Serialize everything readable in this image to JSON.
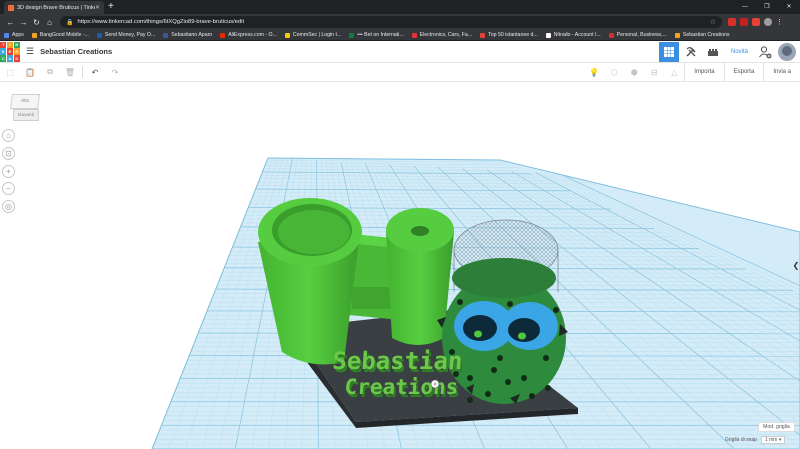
{
  "browser": {
    "tab_title": "3D design Brave Bruticus | Tinke",
    "tab_close": "✕",
    "new_tab": "+",
    "url": "https://www.tinkercad.com/things/6tXQgZio89-brave-bruticus/edit",
    "window_controls": [
      "—",
      "❐",
      "✕"
    ],
    "nav": {
      "back": "←",
      "forward": "→",
      "reload": "↻",
      "home": "⌂"
    },
    "lock": "🔒",
    "star": "☆",
    "menu": "⋮"
  },
  "bookmarks": [
    {
      "label": "Apps",
      "color": "#4f88ee"
    },
    {
      "label": "BangGood Mobile -...",
      "color": "#f4a125"
    },
    {
      "label": "Send Money, Pay O...",
      "color": "#1f5aa6"
    },
    {
      "label": "Sebastiano Aparo",
      "color": "#3b5998"
    },
    {
      "label": "AliExpress.com - O...",
      "color": "#e62e04"
    },
    {
      "label": "CommSec | Login t...",
      "color": "#f6c900"
    },
    {
      "label": "••• Bet on Internati...",
      "color": "#127b3f"
    },
    {
      "label": "Electronics, Cars, Fa...",
      "color": "#e53238"
    },
    {
      "label": "Top 50 istantanee d...",
      "color": "#e94235"
    },
    {
      "label": "Nitrado - Account I...",
      "color": "#ffffff"
    },
    {
      "label": "Personal, Business,...",
      "color": "#d32f2f"
    },
    {
      "label": "Sebastian Creations",
      "color": "#f4a125"
    }
  ],
  "app": {
    "logo_letters": [
      "TIN",
      "KER",
      "CAD"
    ],
    "logo_cells": [
      "T",
      "I",
      "N",
      "K",
      "E",
      "R",
      "C",
      "A",
      "D"
    ],
    "menu_icon": "☰",
    "project_title": "Sebastian Creations",
    "novita": "Novità"
  },
  "toolbar": {
    "left_icons": [
      "⬚",
      "📋",
      "⧉",
      "🗑",
      "↶",
      "↷"
    ],
    "right_icons": [
      "💡",
      "⬡",
      "⬢",
      "⊟",
      "△"
    ],
    "importa": "Importa",
    "esporta": "Esporta",
    "invia": "Invia a"
  },
  "viewcube": {
    "top": "Alto",
    "front": "Davanti"
  },
  "nav_controls": [
    "⌂",
    "⊡",
    "+",
    "−",
    "◎"
  ],
  "workplane": {
    "grid_button": "Mod. griglia",
    "snap_label": "Griglia di snap",
    "snap_value": "1 mm ▾",
    "right_collapse": "❮",
    "model_text_line1": "Sebastian",
    "model_text_line2": "Creations",
    "colors": {
      "grid_bg": "#d4ecf7",
      "grid_line": "#a8d3ea",
      "base_plate": "#3c4145",
      "green": "#4fc43a",
      "green_dark": "#2f9a26",
      "ball": "#2e8a3c",
      "eye": "#3aa6e5",
      "text_green": "#6cc84a"
    }
  }
}
